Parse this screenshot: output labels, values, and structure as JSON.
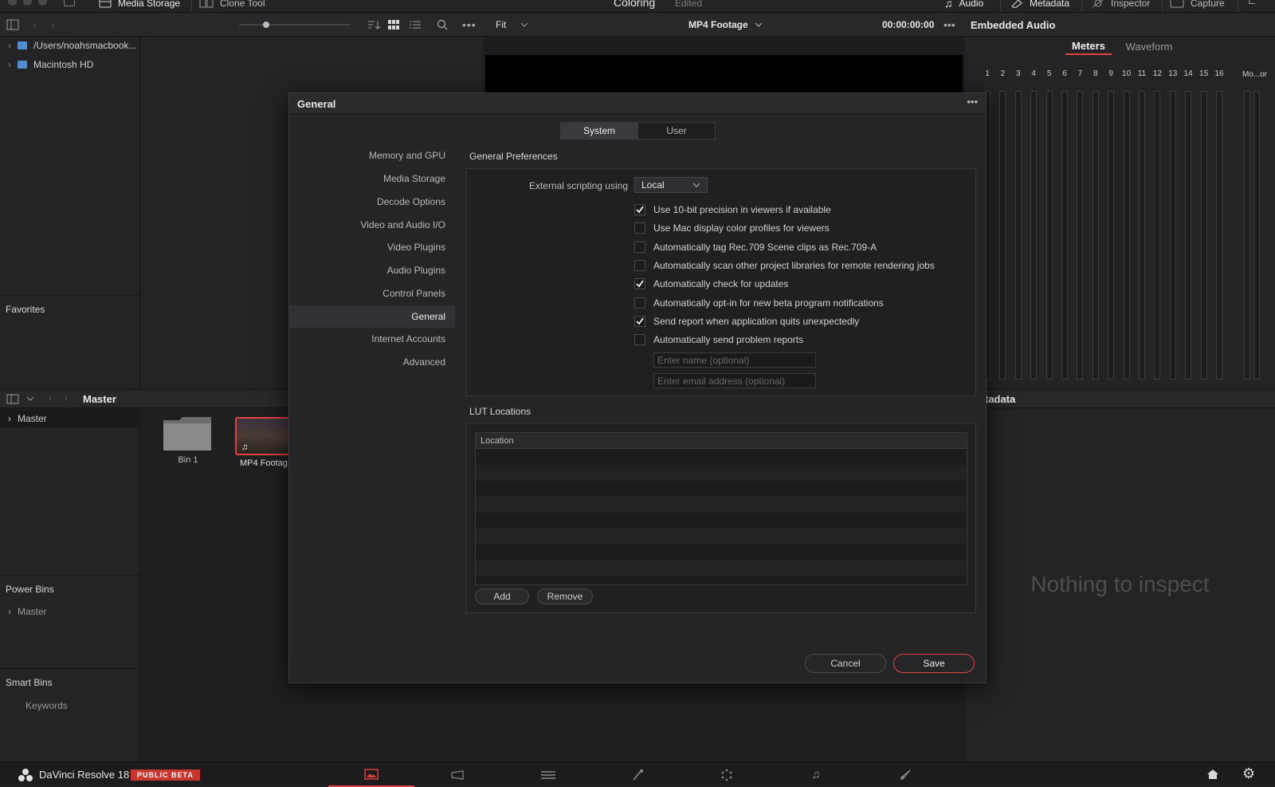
{
  "top_bar": {
    "media_storage": "Media Storage",
    "clone_tool": "Clone Tool",
    "page_title": "Coloring",
    "page_subtitle": "Edited",
    "audio": "Audio",
    "metadata": "Metadata",
    "inspector": "Inspector",
    "capture": "Capture"
  },
  "viewer": {
    "zoom": "Fit",
    "clip_name": "MP4 Footage",
    "timecode": "00:00:00:00"
  },
  "media_storage": {
    "locations": [
      "/Users/noahsmacbook...",
      "Macintosh HD"
    ],
    "favorites_title": "Favorites"
  },
  "media_pool": {
    "current_bin": "Master",
    "tree_root": "Master",
    "items": [
      "Bin 1",
      "MP4 Footag"
    ],
    "power_bins_title": "Power Bins",
    "power_bins": [
      "Master"
    ],
    "smart_bins_title": "Smart Bins",
    "smart_bins": [
      "Keywords"
    ]
  },
  "audio_panel": {
    "title": "Embedded Audio",
    "tabs": [
      "Meters",
      "Waveform"
    ],
    "active_tab": "Meters",
    "channels": [
      "1",
      "2",
      "3",
      "4",
      "5",
      "6",
      "7",
      "8",
      "9",
      "10",
      "11",
      "12",
      "13",
      "14",
      "15",
      "16"
    ],
    "monitor_label": "Mo...or"
  },
  "metadata_panel": {
    "title_fragment": "tadata",
    "empty_text": "Nothing to inspect"
  },
  "dialog": {
    "title": "General",
    "tabs": [
      "System",
      "User"
    ],
    "active_tab": "System",
    "nav": [
      "Memory and GPU",
      "Media Storage",
      "Decode Options",
      "Video and Audio I/O",
      "Video Plugins",
      "Audio Plugins",
      "Control Panels",
      "General",
      "Internet Accounts",
      "Advanced"
    ],
    "active_nav": "General",
    "general_prefs": {
      "title": "General Preferences",
      "scripting_label": "External scripting using",
      "scripting_value": "Local",
      "options": [
        {
          "label": "Use 10-bit precision in viewers if available",
          "checked": true
        },
        {
          "label": "Use Mac display color profiles for viewers",
          "checked": false
        },
        {
          "label": "Automatically tag Rec.709 Scene clips as Rec.709-A",
          "checked": false
        },
        {
          "label": "Automatically scan other project libraries for remote rendering jobs",
          "checked": false
        },
        {
          "label": "Automatically check for updates",
          "checked": true
        },
        {
          "label": "Automatically opt-in for new beta program notifications",
          "checked": false
        },
        {
          "label": "Send report when application quits unexpectedly",
          "checked": true
        },
        {
          "label": "Automatically send problem reports",
          "checked": false
        }
      ],
      "name_placeholder": "Enter name (optional)",
      "email_placeholder": "Enter email address (optional)"
    },
    "lut": {
      "title": "LUT Locations",
      "column": "Location",
      "add_label": "Add",
      "remove_label": "Remove"
    },
    "cancel_label": "Cancel",
    "save_label": "Save"
  },
  "bottom_bar": {
    "app_name": "DaVinci Resolve 18",
    "badge": "PUBLIC BETA"
  },
  "colors": {
    "accent_red": "#e0443c",
    "badge_red": "#c8372d"
  }
}
